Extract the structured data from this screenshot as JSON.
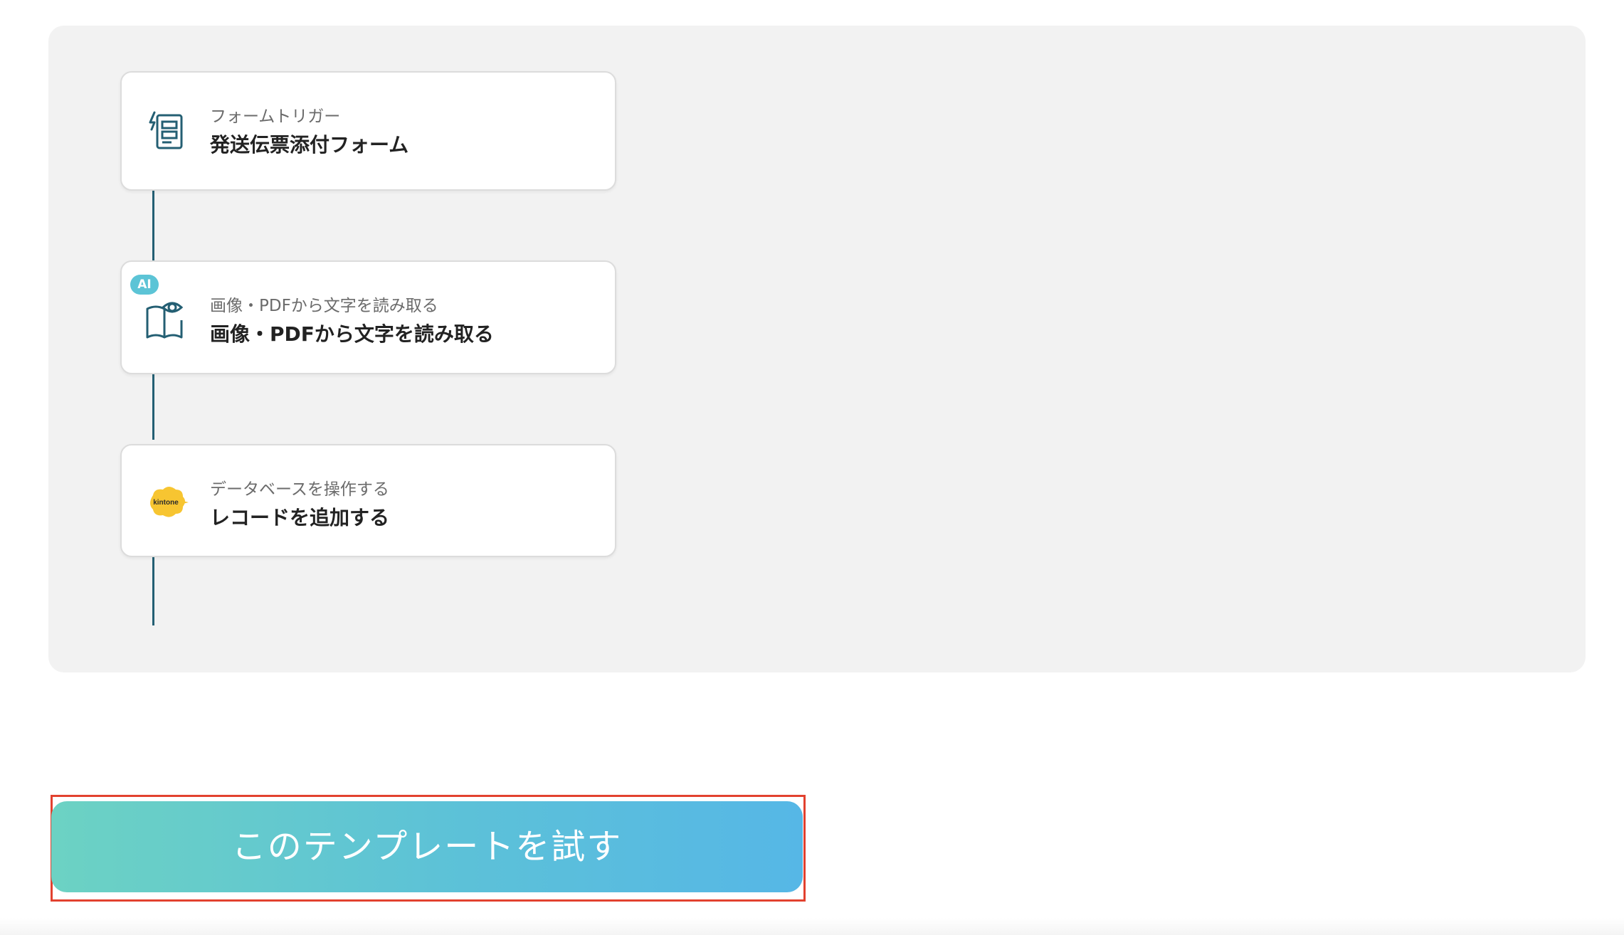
{
  "flow": {
    "steps": [
      {
        "sub_label": "フォームトリガー",
        "title": "発送伝票添付フォーム",
        "icon": "form-trigger-icon"
      },
      {
        "sub_label": "画像・PDFから文字を読み取る",
        "title": "画像・PDFから文字を読み取る",
        "icon": "ocr-book-eye-icon",
        "badge": "AI"
      },
      {
        "sub_label": "データベースを操作する",
        "title": "レコードを追加する",
        "icon": "kintone-logo",
        "logo_text": "kintone"
      }
    ],
    "colors": {
      "panel_background": "#f2f2f2",
      "connector": "#245f73",
      "ai_badge": "#5cc4d6",
      "kintone_yellow": "#f7c531"
    }
  },
  "cta": {
    "label": "このテンプレートを試す",
    "gradient_start": "#6cd2c3",
    "gradient_end": "#56b7e6",
    "highlight_border": "#e2412f"
  }
}
